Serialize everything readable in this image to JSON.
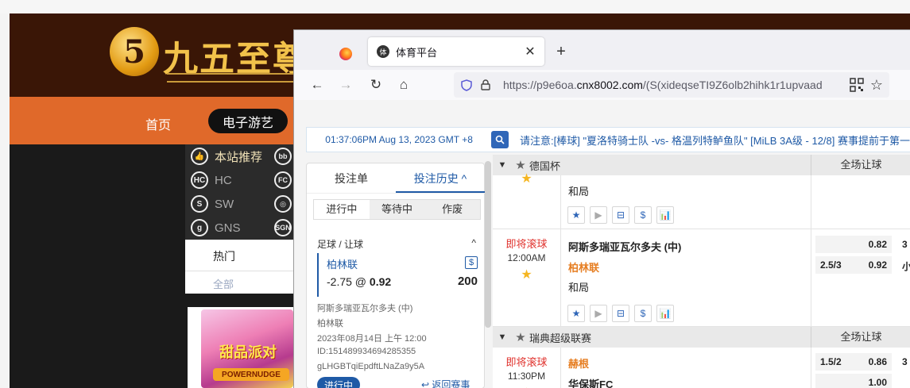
{
  "background_site": {
    "logo_char": "5",
    "logo_text": "九五至尊",
    "nav_home": "首页",
    "nav_active": "电子游艺",
    "side_items": [
      {
        "icon": "thumb-up-icon",
        "badge": "👍",
        "label": "本站推荐"
      },
      {
        "icon": "hc-provider-icon",
        "badge": "HC",
        "label": "HC"
      },
      {
        "icon": "sw-provider-icon",
        "badge": "S",
        "label": "SW"
      },
      {
        "icon": "gns-provider-icon",
        "badge": "g",
        "label": "GNS"
      }
    ],
    "side_icons_right": [
      "bb",
      "FC",
      "◎",
      "SGN"
    ],
    "tab_hot": "热门",
    "tab_all": "全部",
    "game_title": "甜品派对",
    "game_sub": "POWERNUDGE",
    "right_text": " "
  },
  "browser": {
    "tab_title": "体育平台",
    "tab_fav": "体",
    "close_glyph": "✕",
    "new_tab_glyph": "+",
    "back_glyph": "←",
    "forward_glyph": "→",
    "reload_glyph": "↻",
    "home_glyph": "⌂",
    "star_glyph": "☆",
    "url_prefix": "https://p9e6oa.",
    "url_domain": "cnx8002.com",
    "url_suffix": "/(S(xideqseTI9Z6olb2hihk1r1upvaad"
  },
  "ticker": {
    "time": "01:37:06PM Aug 13, 2023 GMT +8",
    "message": "请注意:[棒球] \"夏洛特骑士队 -vs- 格温列特鲈鱼队\" [MiLB 3A级 - 12/8] 赛事提前于第一"
  },
  "bet_slip": {
    "tab_slip": "投注单",
    "tab_history": "投注历史 ^",
    "sub_tabs": [
      "进行中",
      "等待中",
      "作废"
    ],
    "bet_type": "足球 / 让球",
    "collapse_glyph": "^",
    "selection": "柏林联",
    "dollar": "$",
    "odds_line": "-2.75 @",
    "odds_value": "0.92",
    "stake": "200",
    "match": "阿斯多瑞亚瓦尔多夫 (中)",
    "team": "柏林联",
    "datetime": "2023年08月14日 上午 12:00",
    "bet_id": "ID:151489934694285355",
    "ref_code": "gLHGBTqiEpdftLNaZa9y5A",
    "status": "进行中",
    "return_link": "↩ 返回赛事"
  },
  "match_list": {
    "leagues": [
      {
        "name": "德国杯",
        "market": "全场让球"
      },
      {
        "name": "瑞典超级联赛",
        "market": "全场让球"
      }
    ],
    "prev_row": {
      "draw": "和局"
    },
    "row_icons": [
      "★",
      "▶",
      "⊟",
      "$",
      "📊"
    ],
    "match1": {
      "live": "即将滚球",
      "time": "12:00AM",
      "home": "阿斯多瑞亚瓦尔多夫 (中)",
      "away": "柏林联",
      "draw": "和局",
      "odds": [
        {
          "hc": "",
          "price": "0.82",
          "next": "3"
        },
        {
          "hc": "2.5/3",
          "price": "0.92",
          "next": "小"
        }
      ]
    },
    "match2": {
      "live": "即将滚球",
      "time": "11:30PM",
      "home": "赫根",
      "away": "华保斯FC",
      "odds": [
        {
          "hc": "1.5/2",
          "price": "0.86",
          "next": "3"
        },
        {
          "hc": "",
          "price": "1.00",
          "next": ""
        }
      ]
    }
  },
  "colors": {
    "accent_blue": "#1f5aa6",
    "live_red": "#e0322d",
    "nav_orange": "#e0692a",
    "header_brown": "#3a1606"
  }
}
